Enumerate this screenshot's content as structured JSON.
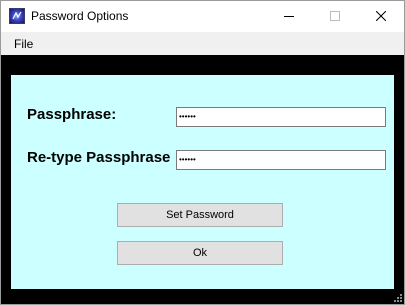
{
  "window": {
    "title": "Password Options",
    "min_icon": "minimize-icon",
    "max_icon": "maximize-icon",
    "close_icon": "close-icon"
  },
  "menu": {
    "file_label": "File"
  },
  "form": {
    "passphrase_label": "Passphrase:",
    "passphrase_value": "••••••",
    "retype_label": "Re-type Passphrase",
    "retype_value": "••••••"
  },
  "buttons": {
    "set_password_label": "Set Password",
    "ok_label": "Ok"
  },
  "colors": {
    "panel_bg": "#ccffff",
    "frame_bg": "#000000",
    "button_bg": "#e1e1e1"
  }
}
